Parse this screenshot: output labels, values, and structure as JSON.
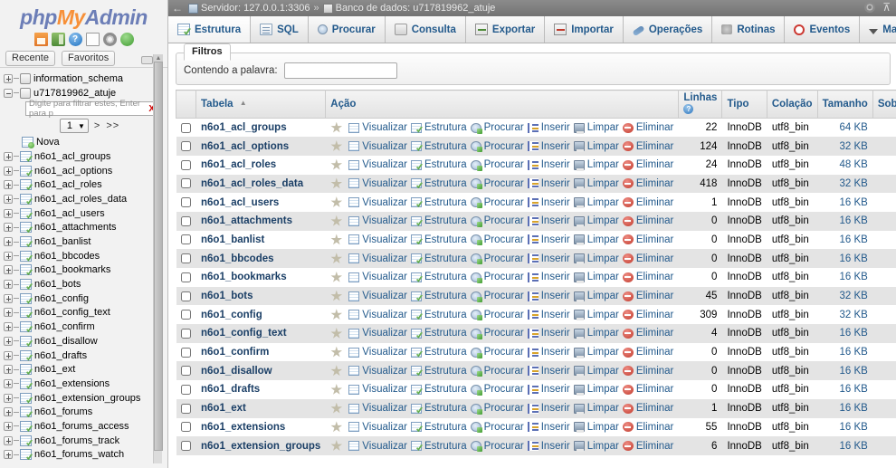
{
  "brand": {
    "part1": "php",
    "part2": "My",
    "part3": "Admin"
  },
  "sidebar": {
    "quick_icons": [
      {
        "name": "home-icon",
        "label": "Home"
      },
      {
        "name": "exit-icon",
        "label": "Sair"
      },
      {
        "name": "help-icon",
        "label": "Ajuda"
      },
      {
        "name": "docs-icon",
        "label": "Documentação"
      },
      {
        "name": "settings-icon",
        "label": "Configurações"
      },
      {
        "name": "reload-icon",
        "label": "Recarregar"
      }
    ],
    "chips": [
      {
        "label": "Recente"
      },
      {
        "label": "Favoritos"
      }
    ],
    "tree": [
      {
        "label": "information_schema",
        "type": "db",
        "expander": "plus"
      },
      {
        "label": "u717819962_atuje",
        "type": "db",
        "expander": "minus"
      }
    ],
    "filter_placeholder": "Digite para filtrar estes, Enter para p",
    "filter_clear": "X",
    "page_value": "1",
    "page_next": ">",
    "page_last": ">>",
    "new_label": "Nova",
    "tables": [
      "n6o1_acl_groups",
      "n6o1_acl_options",
      "n6o1_acl_roles",
      "n6o1_acl_roles_data",
      "n6o1_acl_users",
      "n6o1_attachments",
      "n6o1_banlist",
      "n6o1_bbcodes",
      "n6o1_bookmarks",
      "n6o1_bots",
      "n6o1_config",
      "n6o1_config_text",
      "n6o1_confirm",
      "n6o1_disallow",
      "n6o1_drafts",
      "n6o1_ext",
      "n6o1_extensions",
      "n6o1_extension_groups",
      "n6o1_forums",
      "n6o1_forums_access",
      "n6o1_forums_track",
      "n6o1_forums_watch"
    ]
  },
  "breadcrumb": {
    "back": "←",
    "server_label": "Servidor: 127.0.0.1:3306",
    "separator": "»",
    "database_label": "Banco de dados: u717819962_atuje"
  },
  "tabs": [
    {
      "label": "Estrutura",
      "icon": "structure-icon",
      "active": true
    },
    {
      "label": "SQL",
      "icon": "sql-icon",
      "active": false
    },
    {
      "label": "Procurar",
      "icon": "search-icon",
      "active": false
    },
    {
      "label": "Consulta",
      "icon": "query-icon",
      "active": false
    },
    {
      "label": "Exportar",
      "icon": "export-icon",
      "active": false
    },
    {
      "label": "Importar",
      "icon": "import-icon",
      "active": false
    },
    {
      "label": "Operações",
      "icon": "operations-icon",
      "active": false
    },
    {
      "label": "Rotinas",
      "icon": "routines-icon",
      "active": false
    },
    {
      "label": "Eventos",
      "icon": "events-icon",
      "active": false
    },
    {
      "label": "Mais",
      "icon": "chevron-down-icon",
      "active": false
    }
  ],
  "filters": {
    "legend": "Filtros",
    "word_label": "Contendo a palavra:",
    "word_value": "",
    "word_placeholder": ""
  },
  "table": {
    "headers": {
      "checkbox": "",
      "name": "Tabela",
      "action": "Ação",
      "rows": "Linhas",
      "type": "Tipo",
      "collation": "Colação",
      "size": "Tamanho",
      "overhead": "Sobrecarga"
    },
    "actions": [
      {
        "label": "Visualizar",
        "icon": "browse-icon"
      },
      {
        "label": "Estrutura",
        "icon": "structure-icon"
      },
      {
        "label": "Procurar",
        "icon": "search-icon"
      },
      {
        "label": "Inserir",
        "icon": "insert-icon"
      },
      {
        "label": "Limpar",
        "icon": "empty-icon"
      },
      {
        "label": "Eliminar",
        "icon": "drop-icon"
      }
    ],
    "rows": [
      {
        "name": "n6o1_acl_groups",
        "rows": "22",
        "type": "InnoDB",
        "collation": "utf8_bin",
        "size": "64 KB",
        "overhead": "-"
      },
      {
        "name": "n6o1_acl_options",
        "rows": "124",
        "type": "InnoDB",
        "collation": "utf8_bin",
        "size": "32 KB",
        "overhead": "-"
      },
      {
        "name": "n6o1_acl_roles",
        "rows": "24",
        "type": "InnoDB",
        "collation": "utf8_bin",
        "size": "48 KB",
        "overhead": "-"
      },
      {
        "name": "n6o1_acl_roles_data",
        "rows": "418",
        "type": "InnoDB",
        "collation": "utf8_bin",
        "size": "32 KB",
        "overhead": "-"
      },
      {
        "name": "n6o1_acl_users",
        "rows": "1",
        "type": "InnoDB",
        "collation": "utf8_bin",
        "size": "16 KB",
        "overhead": "-"
      },
      {
        "name": "n6o1_attachments",
        "rows": "0",
        "type": "InnoDB",
        "collation": "utf8_bin",
        "size": "16 KB",
        "overhead": "-"
      },
      {
        "name": "n6o1_banlist",
        "rows": "0",
        "type": "InnoDB",
        "collation": "utf8_bin",
        "size": "16 KB",
        "overhead": "-"
      },
      {
        "name": "n6o1_bbcodes",
        "rows": "0",
        "type": "InnoDB",
        "collation": "utf8_bin",
        "size": "16 KB",
        "overhead": "-"
      },
      {
        "name": "n6o1_bookmarks",
        "rows": "0",
        "type": "InnoDB",
        "collation": "utf8_bin",
        "size": "16 KB",
        "overhead": "-"
      },
      {
        "name": "n6o1_bots",
        "rows": "45",
        "type": "InnoDB",
        "collation": "utf8_bin",
        "size": "32 KB",
        "overhead": "-"
      },
      {
        "name": "n6o1_config",
        "rows": "309",
        "type": "InnoDB",
        "collation": "utf8_bin",
        "size": "32 KB",
        "overhead": "-"
      },
      {
        "name": "n6o1_config_text",
        "rows": "4",
        "type": "InnoDB",
        "collation": "utf8_bin",
        "size": "16 KB",
        "overhead": "-"
      },
      {
        "name": "n6o1_confirm",
        "rows": "0",
        "type": "InnoDB",
        "collation": "utf8_bin",
        "size": "16 KB",
        "overhead": "-"
      },
      {
        "name": "n6o1_disallow",
        "rows": "0",
        "type": "InnoDB",
        "collation": "utf8_bin",
        "size": "16 KB",
        "overhead": "-"
      },
      {
        "name": "n6o1_drafts",
        "rows": "0",
        "type": "InnoDB",
        "collation": "utf8_bin",
        "size": "16 KB",
        "overhead": "-"
      },
      {
        "name": "n6o1_ext",
        "rows": "1",
        "type": "InnoDB",
        "collation": "utf8_bin",
        "size": "16 KB",
        "overhead": "-"
      },
      {
        "name": "n6o1_extensions",
        "rows": "55",
        "type": "InnoDB",
        "collation": "utf8_bin",
        "size": "16 KB",
        "overhead": "-"
      },
      {
        "name": "n6o1_extension_groups",
        "rows": "6",
        "type": "InnoDB",
        "collation": "utf8_bin",
        "size": "16 KB",
        "overhead": "-"
      }
    ]
  },
  "colors": {
    "link": "#235a8c",
    "header_bar": "#7d7d7d",
    "row_alt": "#e4e4e4",
    "brand_blue": "#6c7eb7",
    "brand_orange": "#f79038"
  }
}
